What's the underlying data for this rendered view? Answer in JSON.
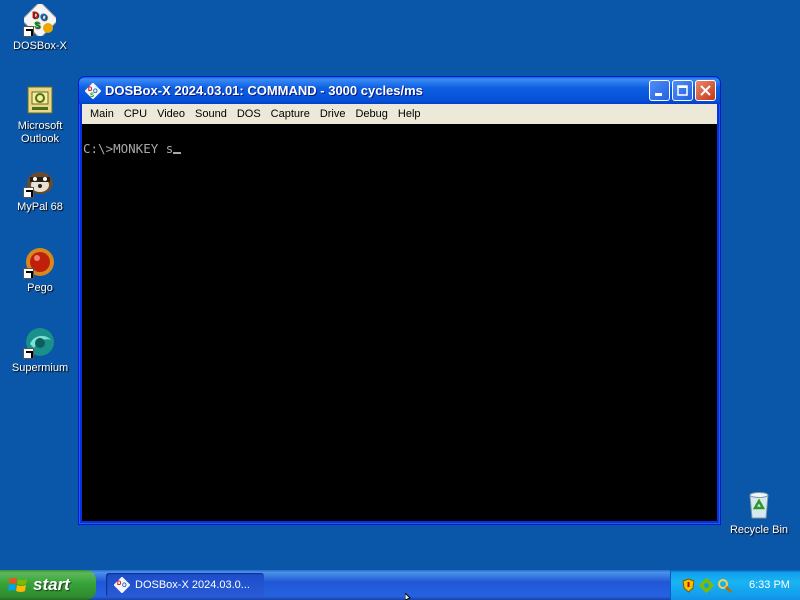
{
  "desktop": {
    "icons": [
      {
        "label": "DOSBox-X",
        "icon": "dosbox-icon"
      },
      {
        "label": "Microsoft Outlook",
        "icon": "outlook-icon"
      },
      {
        "label": "MyPal 68",
        "icon": "mypal-icon"
      },
      {
        "label": "Pego",
        "icon": "pego-icon"
      },
      {
        "label": "Supermium",
        "icon": "supermium-icon"
      },
      {
        "label": "Recycle Bin",
        "icon": "recycle-bin-icon"
      }
    ]
  },
  "window": {
    "title": "DOSBox-X 2024.03.01: COMMAND - 3000 cycles/ms",
    "menu": [
      "Main",
      "CPU",
      "Video",
      "Sound",
      "DOS",
      "Capture",
      "Drive",
      "Debug",
      "Help"
    ],
    "console_line": "C:\\>MONKEY s"
  },
  "taskbar": {
    "start_label": "start",
    "task_label": "DOSBox-X 2024.03.0...",
    "clock": "6:33 PM"
  },
  "colors": {
    "desktop": "#0a56a8",
    "titlebar": "#0550d8",
    "console_bg": "#000000",
    "console_fg": "#a8a8a8"
  }
}
